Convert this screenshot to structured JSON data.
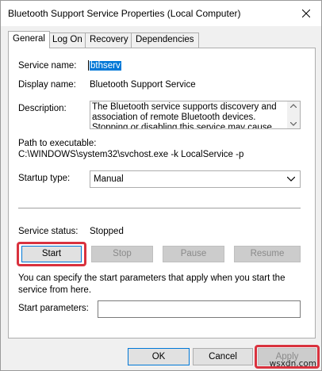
{
  "window": {
    "title": "Bluetooth Support Service Properties (Local Computer)"
  },
  "tabs": [
    {
      "label": "General",
      "active": true
    },
    {
      "label": "Log On",
      "active": false
    },
    {
      "label": "Recovery",
      "active": false
    },
    {
      "label": "Dependencies",
      "active": false
    }
  ],
  "general": {
    "service_name_label": "Service name:",
    "service_name_value": "bthserv",
    "display_name_label": "Display name:",
    "display_name_value": "Bluetooth Support Service",
    "description_label": "Description:",
    "description_value": "The Bluetooth service supports discovery and association of remote Bluetooth devices.  Stopping or disabling this service may cause already installed",
    "path_label": "Path to executable:",
    "path_value": "C:\\WINDOWS\\system32\\svchost.exe -k LocalService -p",
    "startup_type_label": "Startup type:",
    "startup_type_value": "Manual",
    "status_label": "Service status:",
    "status_value": "Stopped",
    "start_button": "Start",
    "stop_button": "Stop",
    "pause_button": "Pause",
    "resume_button": "Resume",
    "info_text": "You can specify the start parameters that apply when you start the service from here.",
    "start_params_label": "Start parameters:",
    "start_params_value": ""
  },
  "footer": {
    "ok_button": "OK",
    "cancel_button": "Cancel",
    "apply_button": "Apply"
  },
  "watermark": "wsxdn.com",
  "colors": {
    "highlight": "#d9323e",
    "selection": "#0078d7"
  }
}
